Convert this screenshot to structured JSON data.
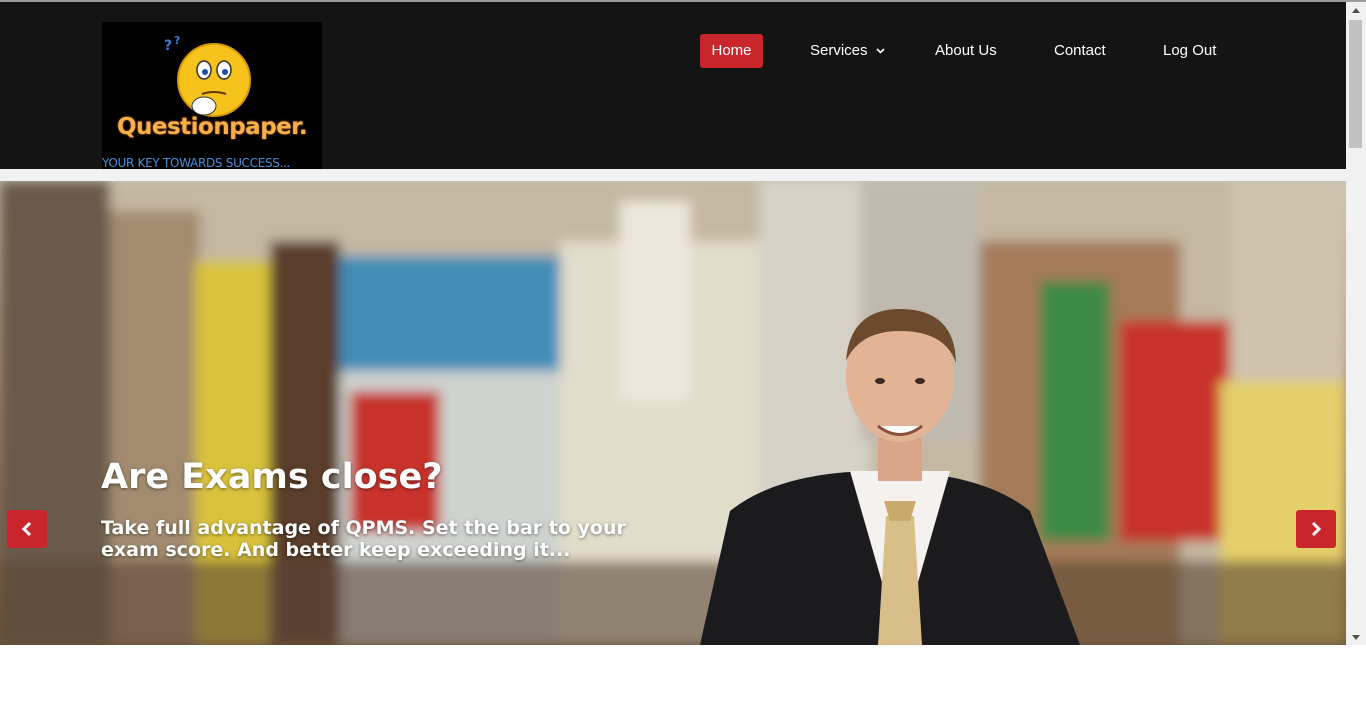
{
  "logo": {
    "title": "Questionpaper.",
    "tagline": "YOUR KEY TOWARDS SUCCESS..."
  },
  "nav": {
    "items": [
      {
        "label": "Home",
        "active": true
      },
      {
        "label": "Services",
        "dropdown": true
      },
      {
        "label": "About Us"
      },
      {
        "label": "Contact"
      },
      {
        "label": "Log Out"
      }
    ]
  },
  "hero": {
    "title": "Are Exams close?",
    "subtitle": "Take full advantage of QPMS. Set the bar to your exam score. And better keep exceeding it..."
  },
  "icons": {
    "prev": "chevron-left-icon",
    "next": "chevron-right-icon",
    "dropdown": "chevron-down-icon"
  },
  "colors": {
    "header_bg": "#141414",
    "accent": "#c8262b",
    "logo_text": "#f5b04a",
    "tagline": "#4a8fd6"
  }
}
